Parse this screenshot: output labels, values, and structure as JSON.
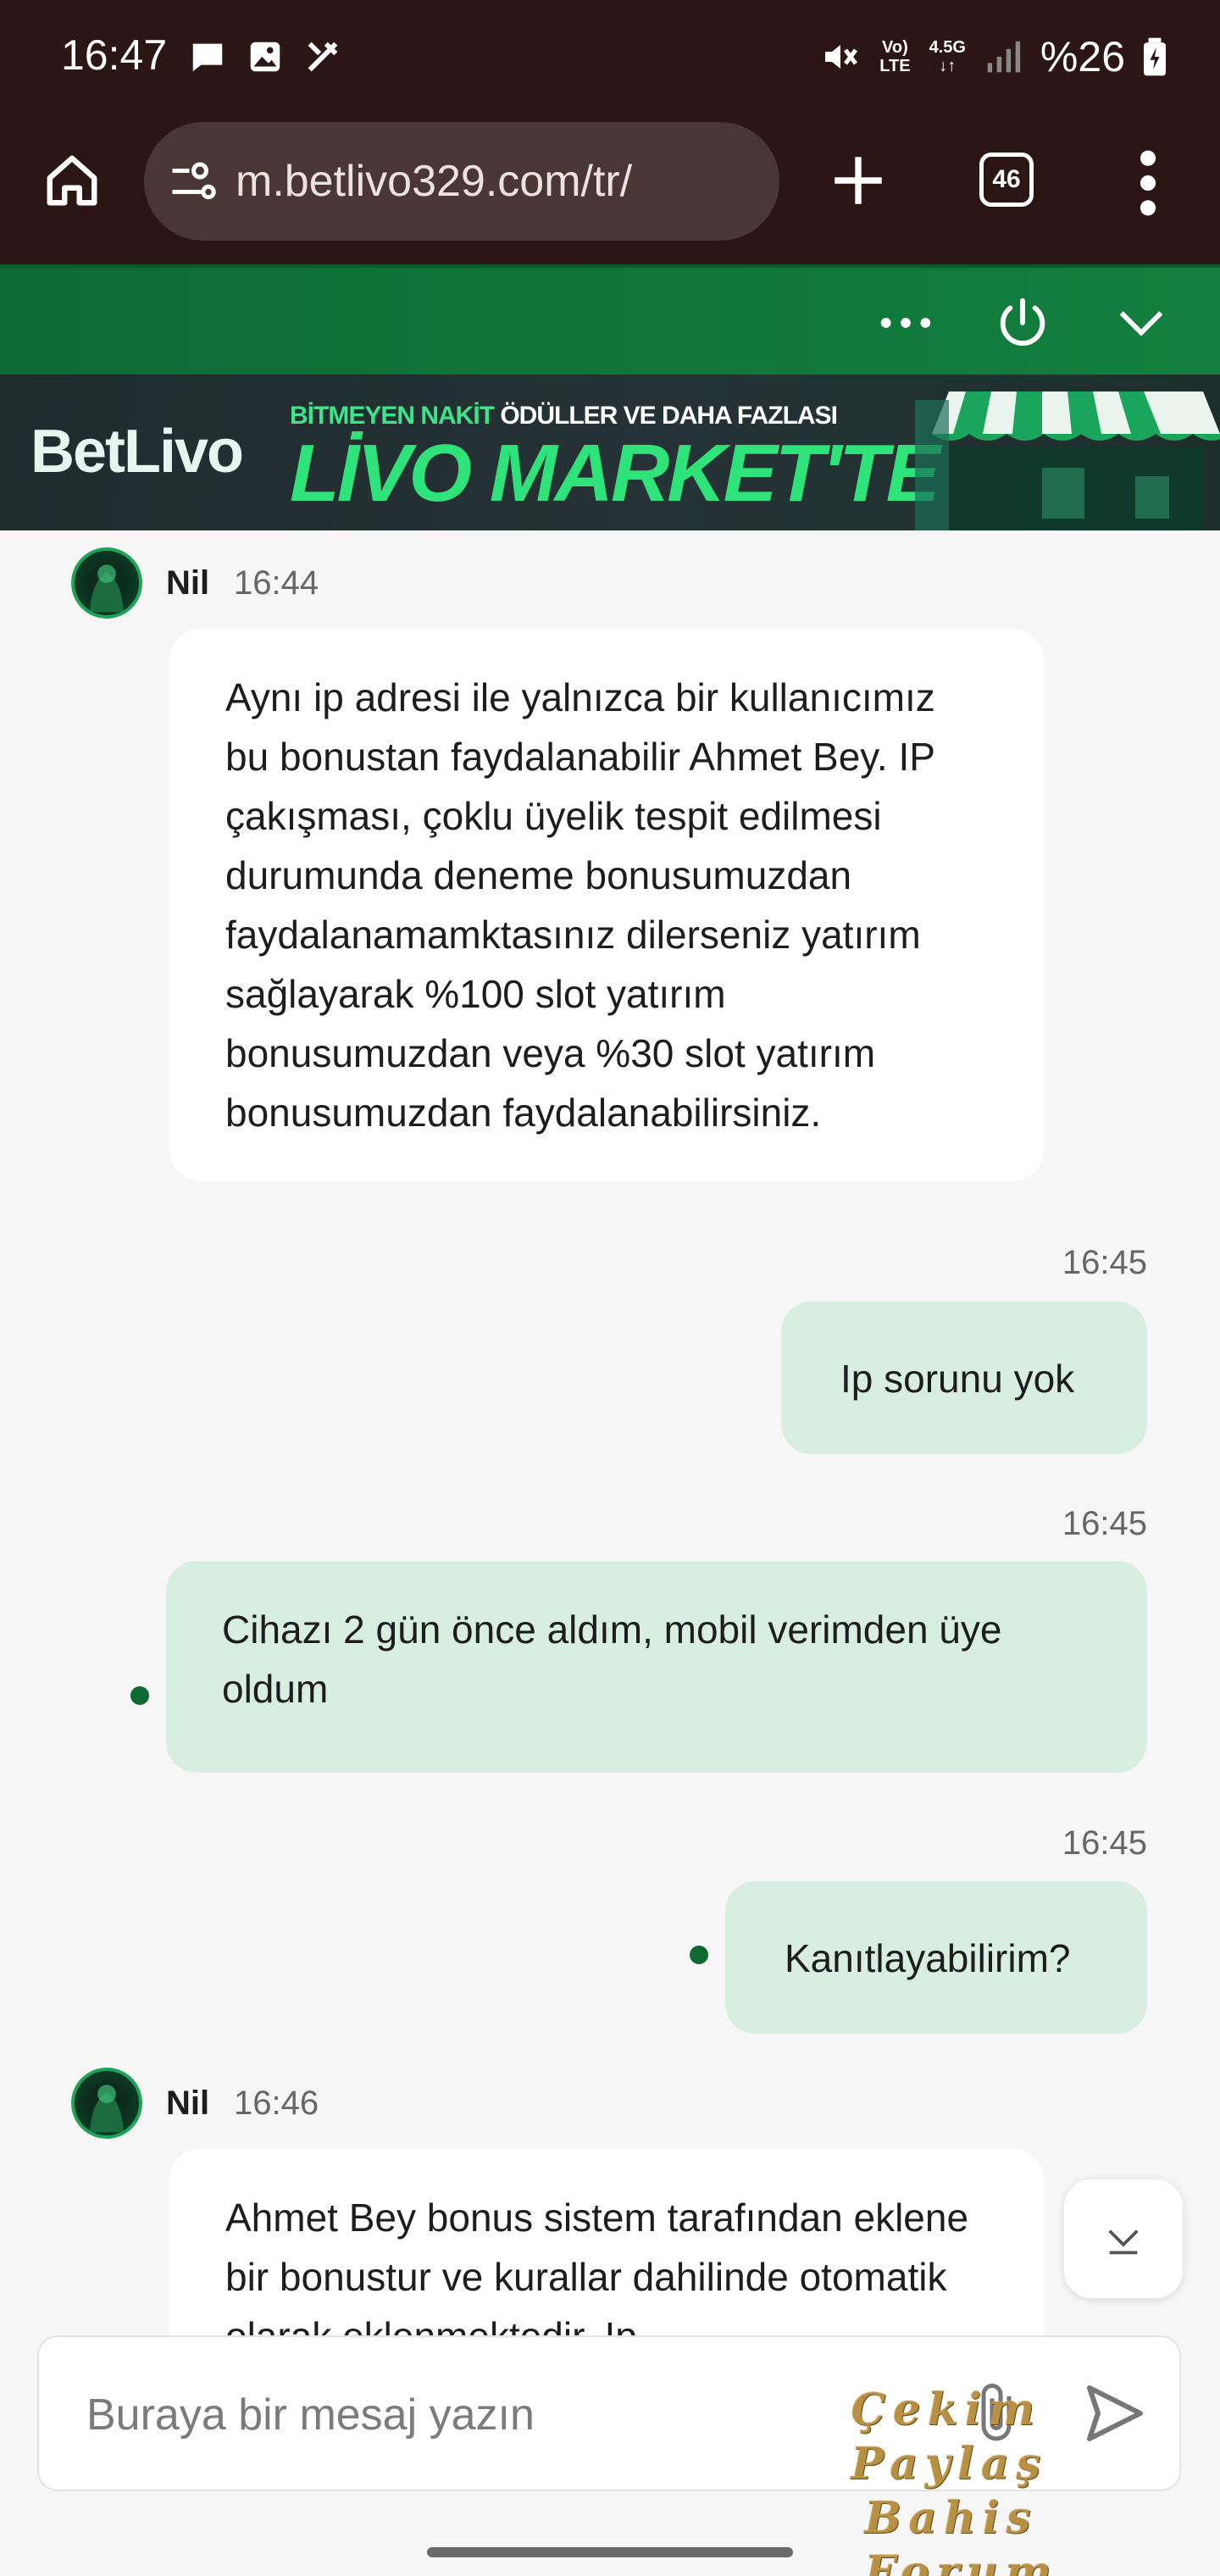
{
  "status_bar": {
    "time": "16:47",
    "network_top": "Vo)",
    "network_bottom": "LTE",
    "data_top": "4.5G",
    "battery": "%26",
    "icons": [
      "chat-bubble-icon",
      "image-icon",
      "tools-icon",
      "mute-icon",
      "signal-icon",
      "battery-charging-icon"
    ]
  },
  "browser": {
    "url": "m.betlivo329.com/tr/",
    "tab_count": "46",
    "icons": [
      "home-icon",
      "site-settings-icon",
      "plus-icon",
      "more-vert-icon"
    ]
  },
  "chat_header": {
    "icons": [
      "more-horiz-icon",
      "power-icon",
      "chevron-down-icon"
    ],
    "color": "#0e6a33"
  },
  "banner": {
    "logo_bet": "Bet",
    "logo_livo": "Livo",
    "subtitle_a": "BİTMEYEN NAKİT ",
    "subtitle_b": "ÖDÜLLER VE DAHA FAZLASI",
    "headline": "LİVO MARKET'TE"
  },
  "messages": [
    {
      "type": "agent",
      "sender": "Nil",
      "time": "16:44",
      "text": "Aynı ip adresi ile yalnızca bir kullanıcımız bu bonustan faydalanabilir Ahmet Bey. IP çakışması, çoklu üyelik tespit edilmesi durumunda deneme bonusumuzdan faydalanamamktasınız dilerseniz yatırım sağlayarak %100 slot yatırım bonusumuzdan veya %30 slot yatırım bonusumuzdan faydalanabilirsiniz."
    },
    {
      "type": "user",
      "time": "16:45",
      "text": "Ip sorunu yok"
    },
    {
      "type": "user",
      "time": "16:45",
      "text": "Cihazı 2 gün önce aldım, mobil verimden üye oldum"
    },
    {
      "type": "user",
      "time": "16:45",
      "text": "Kanıtlayabilirim?"
    },
    {
      "type": "agent",
      "sender": "Nil",
      "time": "16:46",
      "text": "Ahmet Bey bonus sistem tarafından eklene bir bonustur ve kurallar dahilinde otomatik olarak eklenmektedir. Ip"
    }
  ],
  "input": {
    "placeholder": "Buraya bir mesaj yazın",
    "icons": [
      "attach-icon",
      "send-icon"
    ]
  },
  "scroll_button": {
    "icon": "scroll-down-icon"
  },
  "watermark": {
    "line1": "Çekim Paylaş",
    "line2": "Bahis Forum"
  }
}
